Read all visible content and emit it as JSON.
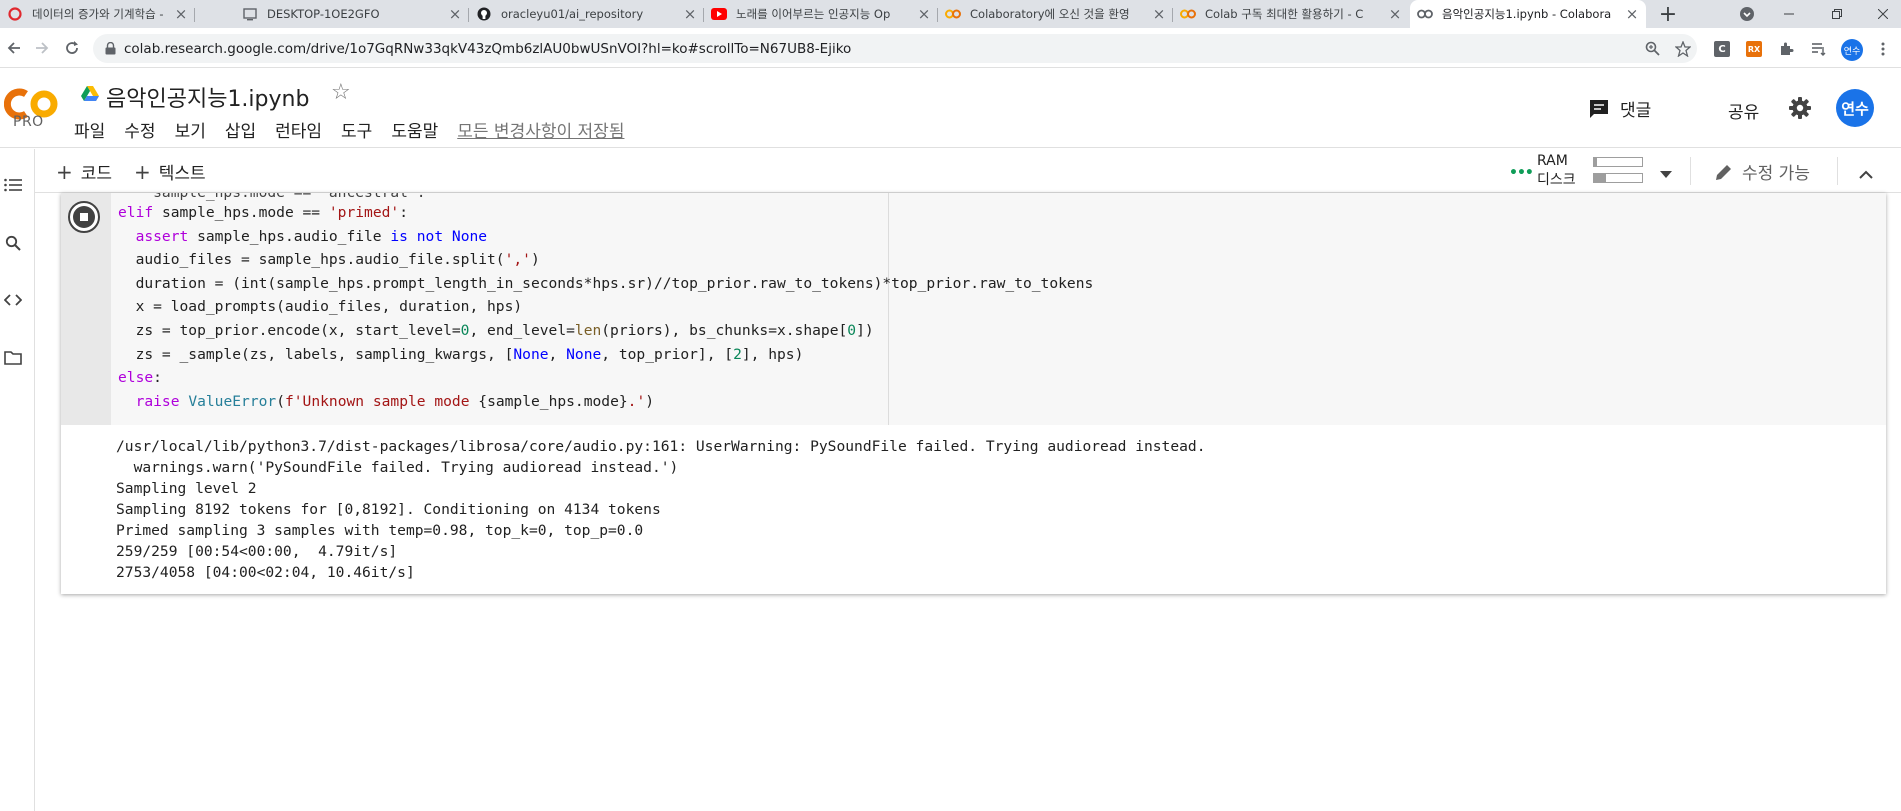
{
  "browser": {
    "tabs": [
      {
        "title": "데이터의 증가와 기계학습 - Da",
        "icon": "opera-icon"
      },
      {
        "title": "DESKTOP-1OE2GFO",
        "icon": "remote-desktop-icon"
      },
      {
        "title": "oracleyu01/ai_repository",
        "icon": "github-icon"
      },
      {
        "title": "노래를 이어부르는 인공지능 Op",
        "icon": "youtube-icon"
      },
      {
        "title": "Colaboratory에 오신 것을 환영",
        "icon": "colab-icon"
      },
      {
        "title": "Colab 구독 최대한 활용하기 - C",
        "icon": "colab-icon"
      },
      {
        "title": "음악인공지능1.ipynb - Colabora",
        "icon": "colab-icon",
        "active": true
      }
    ],
    "url": "colab.research.google.com/drive/1o7GqRNw33qkV43zQmb6zlAU0bwUSnVOI?hl=ko#scrollTo=N67UB8-Ejiko",
    "extensions": [
      "C",
      "RX"
    ],
    "profile_initials": "연수"
  },
  "colab": {
    "logo_text": "CO",
    "plan": "PRO",
    "title": "음악인공지능1.ipynb",
    "menu": [
      "파일",
      "수정",
      "보기",
      "삽입",
      "런타임",
      "도구",
      "도움말"
    ],
    "save_status": "모든 변경사항이 저장됨",
    "comment_label": "댓글",
    "share_label": "공유",
    "user_initials": "연수"
  },
  "toolbar": {
    "add_code": "코드",
    "add_text": "텍스트",
    "ram_label": "RAM",
    "disk_label": "디스크",
    "ram_usage_fraction": 0.06,
    "disk_usage_fraction": 0.26,
    "edit_mode": "수정 가능"
  },
  "cell": {
    "status": "running",
    "cut_line": "    sample_hps.mode == 'ancestral':",
    "code_lines": [
      [
        {
          "t": "elif",
          "c": "kw"
        },
        {
          "t": " sample_hps.mode == "
        },
        {
          "t": "'primed'",
          "c": "st"
        },
        {
          "t": ":"
        }
      ],
      [
        {
          "t": "  "
        },
        {
          "t": "assert",
          "c": "kw"
        },
        {
          "t": " sample_hps.audio_file "
        },
        {
          "t": "is not",
          "c": "bl"
        },
        {
          "t": " "
        },
        {
          "t": "None",
          "c": "bl"
        }
      ],
      [
        {
          "t": "  audio_files = sample_hps.audio_file.split("
        },
        {
          "t": "','",
          "c": "st"
        },
        {
          "t": ")"
        }
      ],
      [
        {
          "t": "  duration = (int(sample_hps.prompt_length_in_seconds*hps.sr)//top_prior.raw_to_tokens)*top_prior.raw_to_tokens"
        }
      ],
      [
        {
          "t": "  x = load_prompts(audio_files, duration, hps)"
        }
      ],
      [
        {
          "t": "  zs = top_prior.encode(x, start_level="
        },
        {
          "t": "0",
          "c": "nm"
        },
        {
          "t": ", end_level="
        },
        {
          "t": "len",
          "c": "fn"
        },
        {
          "t": "(priors), bs_chunks=x.shape["
        },
        {
          "t": "0",
          "c": "nm"
        },
        {
          "t": "])"
        }
      ],
      [
        {
          "t": "  zs = _sample(zs, labels, sampling_kwargs, ["
        },
        {
          "t": "None",
          "c": "bl"
        },
        {
          "t": ", "
        },
        {
          "t": "None",
          "c": "bl"
        },
        {
          "t": ", top_prior], ["
        },
        {
          "t": "2",
          "c": "nm"
        },
        {
          "t": "], hps)"
        }
      ],
      [
        {
          "t": "else",
          "c": "kw"
        },
        {
          "t": ":"
        }
      ],
      [
        {
          "t": "  "
        },
        {
          "t": "raise",
          "c": "kw"
        },
        {
          "t": " "
        },
        {
          "t": "ValueError",
          "c": "ty"
        },
        {
          "t": "("
        },
        {
          "t": "f'Unknown sample mode ",
          "c": "st"
        },
        {
          "t": "{sample_hps.mode}"
        },
        {
          "t": ".'",
          "c": "st"
        },
        {
          "t": ")"
        }
      ]
    ],
    "output_lines": [
      "/usr/local/lib/python3.7/dist-packages/librosa/core/audio.py:161: UserWarning: PySoundFile failed. Trying audioread instead.",
      "  warnings.warn('PySoundFile failed. Trying audioread instead.')",
      "Sampling level 2",
      "Sampling 8192 tokens for [0,8192]. Conditioning on 4134 tokens",
      "Primed sampling 3 samples with temp=0.98, top_k=0, top_p=0.0",
      "259/259 [00:54<00:00,  4.79it/s]",
      "2753/4058 [04:00<02:04, 10.46it/s]"
    ]
  },
  "colors": {
    "accent": "#1a73e8",
    "colab_orange": "#f9ab00",
    "colab_orange_dark": "#e8710a",
    "ok_green": "#0f9d58"
  }
}
